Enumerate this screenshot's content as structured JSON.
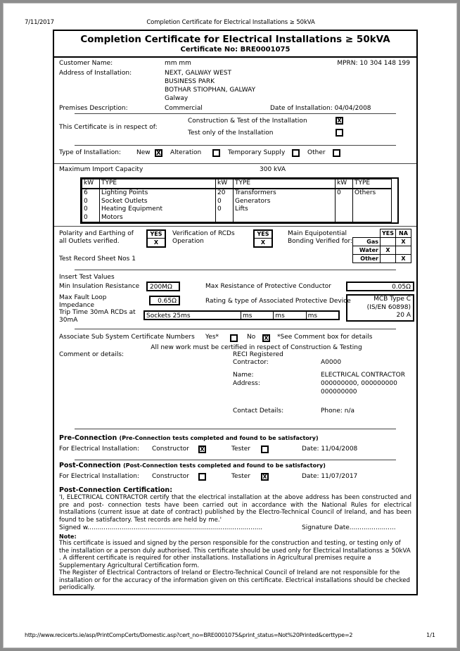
{
  "browser_header": {
    "date": "7/11/2017",
    "title": "Completion Certificate for Electrical Installations ≥ 50kVA"
  },
  "browser_footer": {
    "url": "http://www.recicerts.ie/asp/PrintCompCerts/Domestic.asp?cert_no=BRE0001075&print_status=Not%20Printed&certtype=2",
    "page_number": "1/1"
  },
  "certificate": {
    "title": "Completion Certificate for Electrical Installations ≥ 50kVA",
    "cert_no_label": "Certificate No: BRE0001075",
    "customer": {
      "name_label": "Customer Name:",
      "name_value": "mm  mm",
      "mprn": "MPRN: 10 304 148 199",
      "address_label": "Address of Installation:",
      "address_lines": [
        "NEXT, GALWAY WEST",
        "BUSINESS PARK",
        "BOTHAR STIOPHAN, GALWAY",
        "Galway"
      ],
      "premises_label": "Premises Description:",
      "premises_value": "Commercial",
      "date_installation": "Date of Installation: 04/04/2008"
    },
    "respect_of": {
      "label": "This Certificate is in respect of:",
      "option1": "Construction & Test of the Installation",
      "option1_checked": "X",
      "option2": "Test only of the Installation",
      "option2_checked": ""
    },
    "type_of_installation": {
      "label": "Type of Installation:",
      "options": [
        {
          "label": "New",
          "checked": "X"
        },
        {
          "label": "Alteration",
          "checked": ""
        },
        {
          "label": "Temporary Supply",
          "checked": ""
        },
        {
          "label": "Other",
          "checked": ""
        }
      ]
    },
    "max_import": {
      "label": "Maximum Import Capacity",
      "value": "300 kVA",
      "headers": [
        "kW",
        "TYPE",
        "kW",
        "TYPE",
        "kW",
        "TYPE"
      ],
      "rows": [
        [
          "6",
          "Lighting Points",
          "20",
          "Transformers",
          "0",
          "Others"
        ],
        [
          "0",
          "Socket Outlets",
          "0",
          "Generators",
          "",
          ""
        ],
        [
          "0",
          "Heating Equipment",
          "0",
          "Lifts",
          "",
          ""
        ],
        [
          "0",
          "Motors",
          "",
          "",
          "",
          ""
        ]
      ]
    },
    "polarity": {
      "label_line1": "Polarity and Earthing of",
      "label_line2": "all Outlets verified.",
      "box_head": "YES",
      "box_value": "X",
      "rcd_line1": "Verification of RCDs",
      "rcd_line2": "Operation",
      "rcd_box_head": "YES",
      "rcd_box_value": "X",
      "bonding_line1": "Main Equipotential",
      "bonding_line2": "Bonding Verified for:",
      "bonding_headers": [
        "",
        "YES",
        "NA"
      ],
      "bonding_rows": [
        {
          "name": "Gas",
          "yes": "",
          "na": "X"
        },
        {
          "name": "Water",
          "yes": "X",
          "na": ""
        },
        {
          "name": "Other",
          "yes": "",
          "na": "X"
        }
      ],
      "test_record": "Test Record Sheet Nos 1"
    },
    "test_values": {
      "heading": "Insert Test Values",
      "min_ins_label": "Min Insulation Resistance",
      "min_ins_value": "200MΩ",
      "max_res_label": "Max Resistance of Protective Conductor",
      "max_res_value": "0.05Ω",
      "max_loop_label_l1": "Max Fault Loop",
      "max_loop_label_l2": "Impedance",
      "max_loop_value": "0.65Ω",
      "rating_label": "Rating & type of Associated Protective Device",
      "mcb_l1": "MCB Type C",
      "mcb_l2": "(IS/EN 60898)",
      "mcb_l3": "20 A",
      "trip_label_l1": "Trip Time 30mA RCDs at",
      "trip_label_l2": "30mA",
      "trip_cells": [
        "Sockets 25ms",
        "ms",
        "ms",
        "ms"
      ]
    },
    "sub_system": {
      "label": "Associate Sub System Certificate Numbers",
      "yes_label": "Yes*",
      "yes_checked": "",
      "no_label": "No",
      "no_checked": "X",
      "note": "*See Comment box for details",
      "all_new_work": "All new work must be certified in respect of Construction & Testing"
    },
    "comment": {
      "label": "Comment or details:",
      "reci_label_l1": "RECI Registered",
      "reci_label_l2": "Contractor:",
      "reci_value": "A0000",
      "name_label": "Name:",
      "name_value": "ELECTRICAL CONTRACTOR",
      "address_label": "Address:",
      "address_value_l1": "000000000, 000000000",
      "address_value_l2": "000000000",
      "contact_label": "Contact Details:",
      "contact_value": "Phone: n/a"
    },
    "pre_connection": {
      "heading": "Pre-Connection",
      "heading_note": "(Pre-Connection tests completed and found to be satisfactory)",
      "for_label": "For Electrical Installation:",
      "constructor_label": "Constructor",
      "constructor_checked": "X",
      "tester_label": "Tester",
      "tester_checked": "",
      "date": "Date: 11/04/2008"
    },
    "post_connection": {
      "heading": "Post-Connection",
      "heading_note": "(Post-Connection tests completed and found to be satisfactory)",
      "for_label": "For Electrical Installation:",
      "constructor_label": "Constructor",
      "constructor_checked": "",
      "tester_label": "Tester",
      "tester_checked": "X",
      "date": "Date: 11/07/2017"
    },
    "certification": {
      "heading": "Post-Connection Certification:",
      "body": "'I, ELECTRICAL CONTRACTOR certify that the electrical installation at the above address has been constructed and pre and post- connection tests have been carried out in accordance with the National Rules for electrical Installations (current issue at date of contract) published by the Electro-Technical Council of Ireland, and has been found to be satisfactory. Test records are held by me.'",
      "signed": "Signed w.......................................................................................",
      "signature_date": "Signature Date......................."
    },
    "note": {
      "heading": "Note:",
      "paragraph1": "This certificate is issued and signed by the person responsible for the construction and testing, or testing only of the installation or a person duly authorised. This certificate should be used only for Electrical Installationss ≥ 50kVA . A different certificate is required for other installations. Installations in Agricultural premises require a Supplementary Agricultural Certification form.",
      "paragraph2": "The Register of Electrical Contractors of Ireland or Electro-Technical Council of Ireland are not responsible for the installation or for the accuracy of the information given on this certificate. Electrical installations should be checked periodically."
    }
  }
}
